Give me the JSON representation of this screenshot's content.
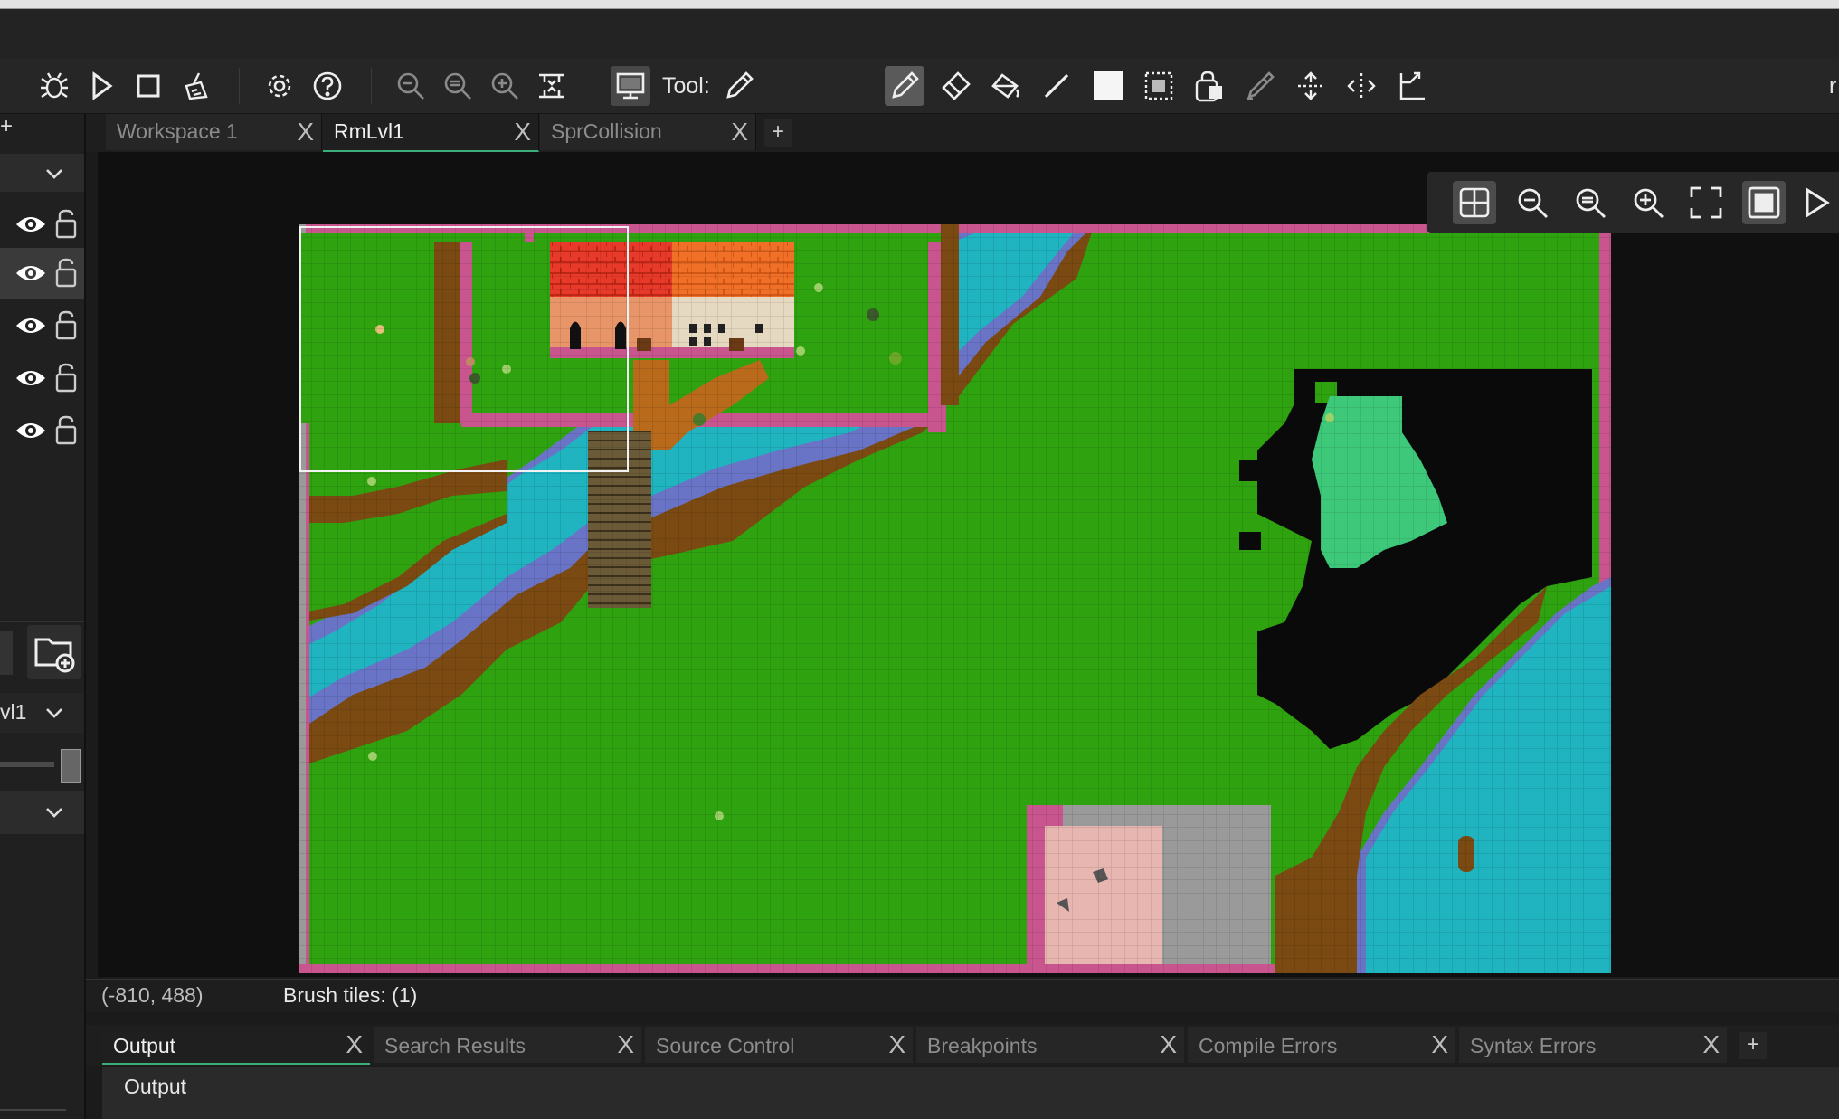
{
  "toolbar": {
    "tool_label": "Tool:",
    "right_edge_text": "r",
    "buttons": [
      "debug-icon",
      "run-icon",
      "stop-icon",
      "clean-icon",
      "settings-icon",
      "help-icon",
      "zoom-out-icon",
      "zoom-reset-icon",
      "zoom-in-icon",
      "fit-icon",
      "screen-icon",
      "pencil-icon"
    ],
    "brush_tools": [
      "pencil-icon",
      "eraser-icon",
      "fill-icon",
      "line-icon",
      "rectangle-icon",
      "select-icon",
      "inherit-icon",
      "picker-icon",
      "flip-vertical-icon",
      "flip-horizontal-icon",
      "rotate-icon"
    ]
  },
  "left_panel": {
    "layers_count": 5,
    "selected_layer": 1,
    "partial_label": "vl1"
  },
  "tabs": [
    {
      "label": "Workspace 1",
      "close": "X",
      "active": false
    },
    {
      "label": "RmLvl1",
      "close": "X",
      "active": true
    },
    {
      "label": "SprCollision",
      "close": "X",
      "active": false
    }
  ],
  "tab_add": "+",
  "left_add": "+",
  "room_toolbar": [
    "grid-icon",
    "zoom-out-icon",
    "zoom-reset-icon",
    "zoom-in-icon",
    "fullscreen-icon",
    "frame-icon",
    "play-icon"
  ],
  "status": {
    "coords": "(-810, 488)",
    "brush": "Brush tiles: (1)"
  },
  "output_tabs": [
    {
      "label": "Output",
      "close": "X",
      "active": true
    },
    {
      "label": "Search Results",
      "close": "X",
      "active": false
    },
    {
      "label": "Source Control",
      "close": "X",
      "active": false
    },
    {
      "label": "Breakpoints",
      "close": "X",
      "active": false
    },
    {
      "label": "Compile Errors",
      "close": "X",
      "active": false
    },
    {
      "label": "Syntax Errors",
      "close": "X",
      "active": false
    }
  ],
  "output_add": "+",
  "output_body": "Output",
  "colors": {
    "grass": "#2fa30f",
    "dirt": "#7a4a12",
    "water": "#1fb4bf",
    "water_edge": "#6a74c6",
    "wall": "#c9558f",
    "stone": "#9a9a9a",
    "accent": "#3cae7a"
  }
}
